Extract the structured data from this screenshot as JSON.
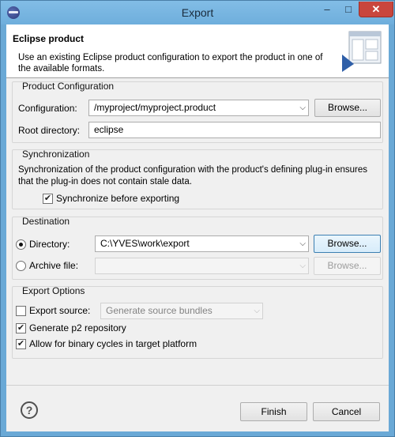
{
  "window": {
    "title": "Export",
    "minimize_glyph": "–",
    "maximize_glyph": "□",
    "close_glyph": "✕"
  },
  "header": {
    "title": "Eclipse product",
    "description": "Use an existing Eclipse product configuration to export the product in one of the available formats."
  },
  "product_configuration": {
    "group_label": "Product Configuration",
    "configuration_label": "Configuration:",
    "configuration_value": "/myproject/myproject.product",
    "browse_label": "Browse...",
    "root_label": "Root directory:",
    "root_value": "eclipse"
  },
  "synchronization": {
    "group_label": "Synchronization",
    "description": "Synchronization of the product configuration with the product's defining plug-in ensures that the plug-in does not contain stale data.",
    "checkbox_label": "Synchronize before exporting",
    "checked": true
  },
  "destination": {
    "group_label": "Destination",
    "directory_label": "Directory:",
    "directory_value": "C:\\YVES\\work\\export",
    "directory_selected": true,
    "directory_browse": "Browse...",
    "archive_label": "Archive file:",
    "archive_value": "",
    "archive_browse": "Browse..."
  },
  "export_options": {
    "group_label": "Export Options",
    "export_source_label": "Export source:",
    "export_source_checked": false,
    "export_source_value": "Generate source bundles",
    "p2_label": "Generate p2 repository",
    "p2_checked": true,
    "binary_cycles_label": "Allow for binary cycles in target platform",
    "binary_cycles_checked": true
  },
  "footer": {
    "finish_label": "Finish",
    "cancel_label": "Cancel",
    "help_glyph": "?"
  },
  "icons": {
    "checkmark": "✔",
    "dropdown_arrow": "⌵"
  }
}
